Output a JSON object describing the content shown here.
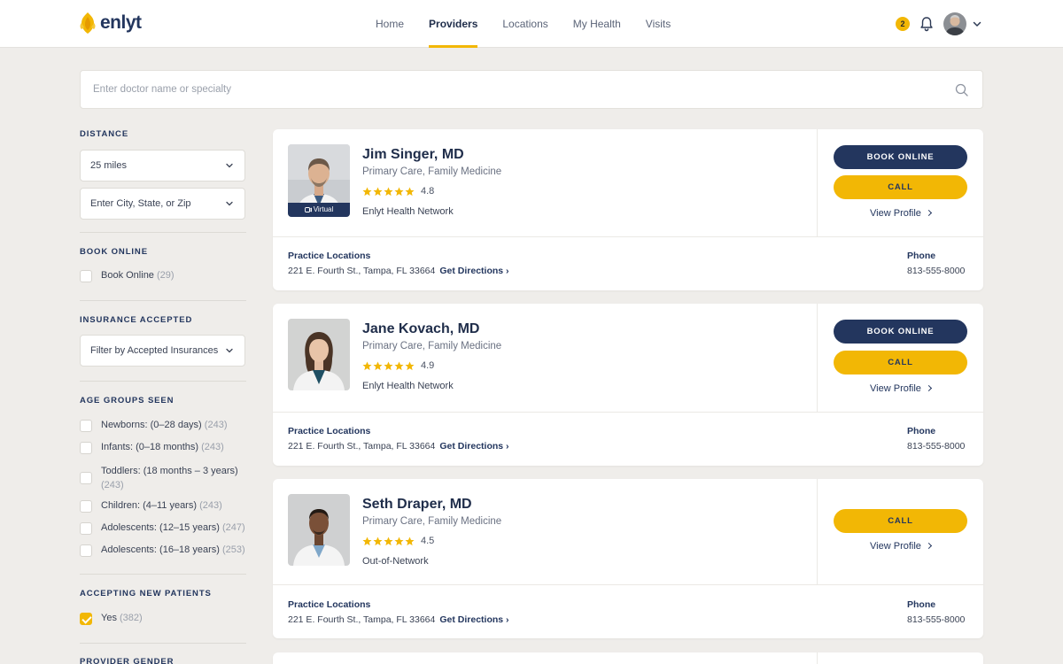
{
  "header": {
    "brand": "enlyt",
    "nav": [
      {
        "label": "Home"
      },
      {
        "label": "Providers"
      },
      {
        "label": "Locations"
      },
      {
        "label": "My Health"
      },
      {
        "label": "Visits"
      }
    ],
    "active_nav": "Providers",
    "notification_count": "2"
  },
  "search": {
    "placeholder": "Enter doctor name or specialty"
  },
  "filters": {
    "distance": {
      "title": "DISTANCE",
      "value": "25 miles",
      "location_value": "Enter City, State, or Zip"
    },
    "book_online": {
      "title": "BOOK ONLINE",
      "label": "Book Online",
      "count": "(29)"
    },
    "insurance": {
      "title": "INSURANCE ACCEPTED",
      "value": "Filter by Accepted Insurances"
    },
    "age_groups": {
      "title": "AGE GROUPS SEEN",
      "items": [
        {
          "label": "Newborns: (0–28 days)",
          "count": "(243)"
        },
        {
          "label": "Infants: (0–18 months)",
          "count": "(243)"
        },
        {
          "label": "Toddlers: (18 months – 3 years)",
          "count": "(243)"
        },
        {
          "label": "Children: (4–11 years)",
          "count": "(243)"
        },
        {
          "label": "Adolescents: (12–15 years)",
          "count": "(247)"
        },
        {
          "label": "Adolescents: (16–18 years)",
          "count": "(253)"
        }
      ]
    },
    "new_patients": {
      "title": "ACCEPTING NEW PATIENTS",
      "label": "Yes",
      "count": "(382)",
      "checked": true
    },
    "gender": {
      "title": "PROVIDER GENDER"
    }
  },
  "providers": [
    {
      "name": "Jim Singer, MD",
      "specialty": "Primary Care, Family Medicine",
      "rating": "4.8",
      "network": "Enlyt Health Network",
      "virtual_label": "Virtual",
      "book_label": "BOOK ONLINE",
      "call_label": "CALL",
      "profile_label": "View Profile",
      "locations_title": "Practice Locations",
      "address": "221 E. Fourth St., Tampa, FL 33664",
      "directions_label": "Get Directions ›",
      "phone_label": "Phone",
      "phone": "813-555-8000"
    },
    {
      "name": "Jane Kovach, MD",
      "specialty": "Primary Care, Family Medicine",
      "rating": "4.9",
      "network": "Enlyt Health Network",
      "book_label": "BOOK ONLINE",
      "call_label": "CALL",
      "profile_label": "View Profile",
      "locations_title": "Practice Locations",
      "address": "221 E. Fourth St., Tampa, FL 33664",
      "directions_label": "Get Directions ›",
      "phone_label": "Phone",
      "phone": "813-555-8000"
    },
    {
      "name": "Seth Draper, MD",
      "specialty": "Primary Care, Family Medicine",
      "rating": "4.5",
      "network": "Out-of-Network",
      "call_label": "CALL",
      "profile_label": "View Profile",
      "locations_title": "Practice Locations",
      "address": "221 E. Fourth St., Tampa, FL 33664",
      "directions_label": "Get Directions ›",
      "phone_label": "Phone",
      "phone": "813-555-8000"
    }
  ],
  "colors": {
    "brand_navy": "#23365e",
    "accent_yellow": "#f2b705",
    "page_bg": "#efedea"
  },
  "icons": [
    "enlyt-logo-icon",
    "bell-icon",
    "chevron-down-icon",
    "search-icon",
    "star-icon",
    "video-camera-icon",
    "chevron-right-icon",
    "checkmark-icon"
  ]
}
